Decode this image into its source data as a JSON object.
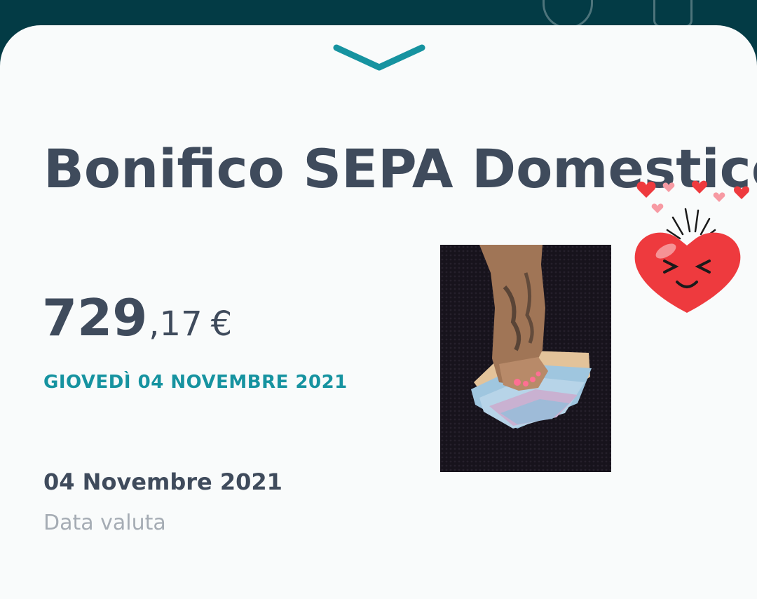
{
  "status_bar": {
    "icons": [
      "phone-icon",
      "bell-icon"
    ]
  },
  "sheet": {
    "handle_icon": "chevron-down-icon",
    "title": "Bonifico SEPA Domestico",
    "amount": {
      "integer": "729",
      "decimal": ",17",
      "currency": "€"
    },
    "date_heading": "GIOVEDÌ 04 NOVEMBRE 2021",
    "value_date": "04 Novembre 2021",
    "value_date_label": "Data valuta"
  },
  "overlays": {
    "photo": "foot-on-banknotes-photo",
    "sticker": "heart-face-sticker"
  },
  "colors": {
    "header_bg": "#033b45",
    "sheet_bg": "#f9fbfb",
    "title": "#3f4b5c",
    "accent": "#1693a0",
    "muted": "#a5acb4",
    "heart": "#ee3a3e"
  }
}
